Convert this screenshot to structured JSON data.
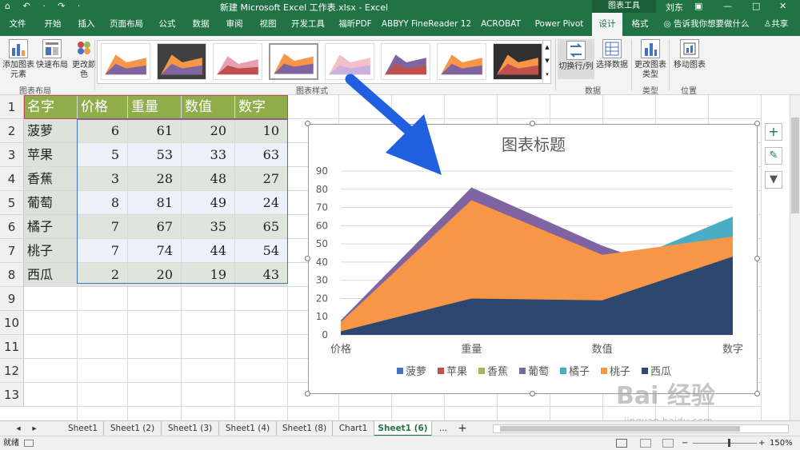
{
  "titlebar": {
    "quick_access": "⌂ ↶ · ↷ ·",
    "document_title": "新建 Microsoft Excel 工作表.xlsx  -  Excel",
    "context_tools": "图表工具",
    "user": "刘东",
    "restore": "▣",
    "minimize": "—",
    "maximize": "□",
    "close": "✕"
  },
  "ribbon_tabs": [
    "文件",
    "开始",
    "插入",
    "页面布局",
    "公式",
    "数据",
    "审阅",
    "视图",
    "开发工具",
    "福昕PDF",
    "ABBYY FineReader 12",
    "ACROBAT",
    "Power Pivot",
    "设计",
    "格式"
  ],
  "ribbon_right": {
    "tell_me": "告诉我你想要做什么",
    "share": "共享"
  },
  "ribbon": {
    "add_element": "添加图表元素",
    "quick_layout": "快速布局",
    "change_colors": "更改颜色",
    "group_layout": "图表布局",
    "group_styles": "图表样式",
    "switch_rowcol": "切换行/列",
    "select_data": "选择数据",
    "group_data": "数据",
    "change_type": "更改图表类型",
    "group_type": "类型",
    "move_chart": "移动图表",
    "group_location": "位置"
  },
  "table": {
    "headers": [
      "名字",
      "价格",
      "重量",
      "数值",
      "数字"
    ],
    "rows": [
      [
        "菠萝",
        "6",
        "61",
        "20",
        "10"
      ],
      [
        "苹果",
        "5",
        "53",
        "33",
        "63"
      ],
      [
        "香蕉",
        "3",
        "28",
        "48",
        "27"
      ],
      [
        "葡萄",
        "8",
        "81",
        "49",
        "24"
      ],
      [
        "橘子",
        "7",
        "67",
        "35",
        "65"
      ],
      [
        "桃子",
        "7",
        "74",
        "44",
        "54"
      ],
      [
        "西瓜",
        "2",
        "20",
        "19",
        "43"
      ]
    ],
    "row_numbers": [
      "1",
      "2",
      "3",
      "4",
      "5",
      "6",
      "7",
      "8",
      "9",
      "10",
      "11",
      "12",
      "13"
    ]
  },
  "chart_data": {
    "type": "area",
    "title": "图表标题",
    "categories": [
      "价格",
      "重量",
      "数值",
      "数字"
    ],
    "ylim": [
      0,
      90
    ],
    "yticks": [
      "0",
      "10",
      "20",
      "30",
      "40",
      "50",
      "60",
      "70",
      "80",
      "90"
    ],
    "grid": true,
    "legend_position": "bottom",
    "series": [
      {
        "name": "菠萝",
        "values": [
          6,
          61,
          20,
          10
        ],
        "color": "#4472c4"
      },
      {
        "name": "苹果",
        "values": [
          5,
          53,
          33,
          63
        ],
        "color": "#c0504d"
      },
      {
        "name": "香蕉",
        "values": [
          3,
          28,
          48,
          27
        ],
        "color": "#9bbb59"
      },
      {
        "name": "葡萄",
        "values": [
          8,
          81,
          49,
          24
        ],
        "color": "#8064a2"
      },
      {
        "name": "橘子",
        "values": [
          7,
          67,
          35,
          65
        ],
        "color": "#4bacc6"
      },
      {
        "name": "桃子",
        "values": [
          7,
          74,
          44,
          54
        ],
        "color": "#f79646"
      },
      {
        "name": "西瓜",
        "values": [
          2,
          20,
          19,
          43
        ],
        "color": "#2c4770"
      }
    ]
  },
  "chart_side_buttons": [
    "+",
    "✎",
    "▼"
  ],
  "sheets": {
    "tabs": [
      "Sheet1",
      "Sheet1 (2)",
      "Sheet1 (3)",
      "Sheet1 (4)",
      "Sheet1 (8)",
      "Chart1",
      "Sheet1 (6)"
    ],
    "active": "Sheet1 (6)",
    "more": "...",
    "add": "+",
    "nav_left": "◂",
    "nav_right": "▸"
  },
  "status": {
    "ready": "就绪",
    "zoom": "150%",
    "zoom_minus": "−",
    "zoom_plus": "+"
  },
  "watermark": {
    "main": "Bai 经验",
    "sub": "jingyan.baidu.com"
  },
  "colors": {
    "excel_green": "#217346",
    "arrow_blue": "#1f5fe0"
  }
}
